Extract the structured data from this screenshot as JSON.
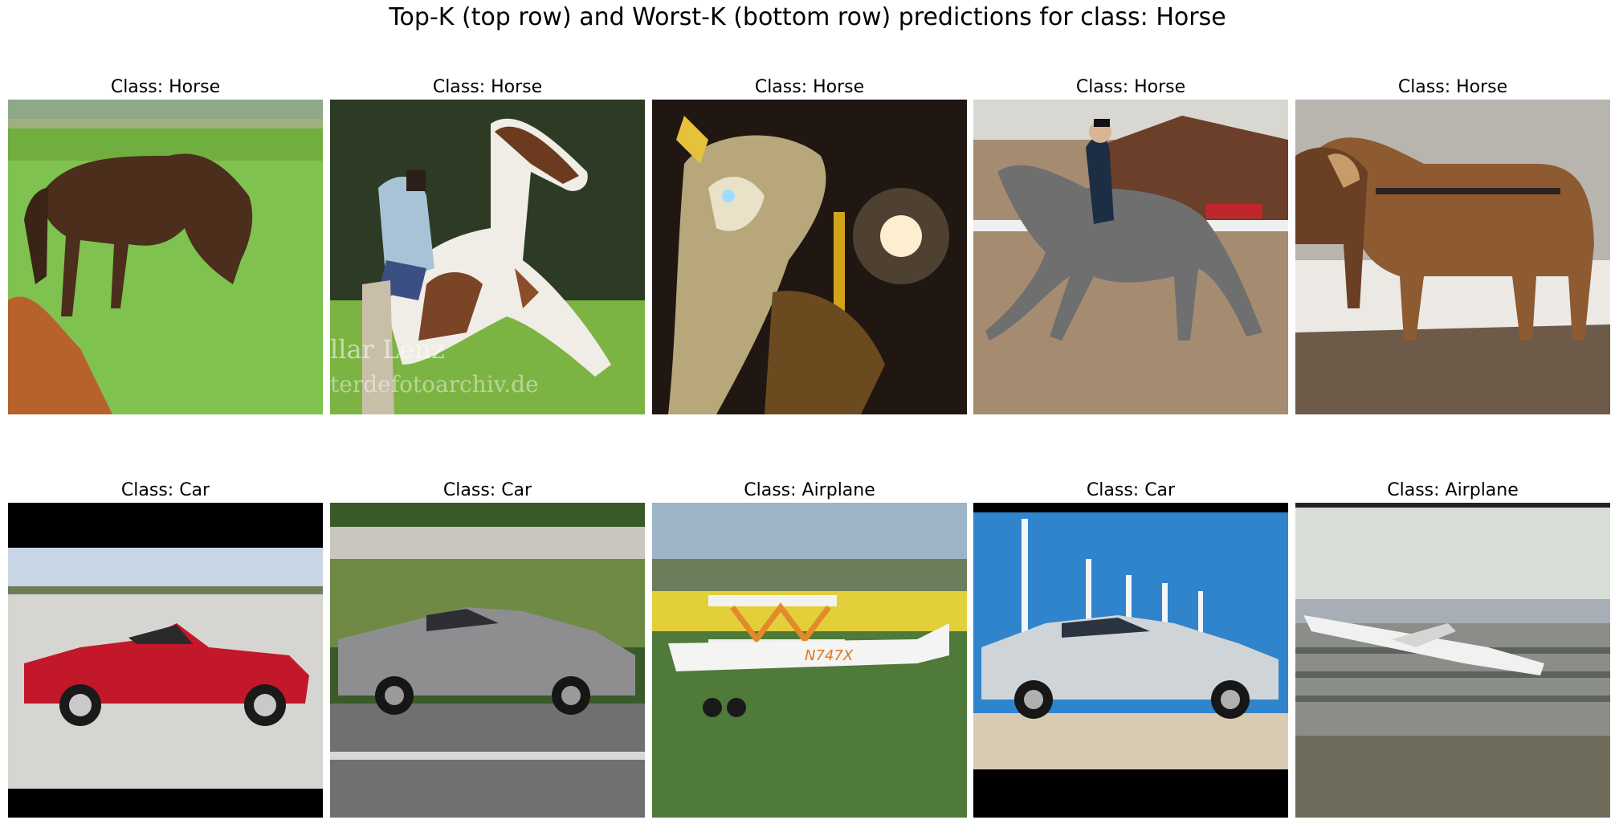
{
  "figure": {
    "title": "Top-K (top row) and Worst-K (bottom row) predictions for class: Horse"
  },
  "rows": [
    {
      "panels": [
        {
          "title": "Class: Horse",
          "scene": "brown horse grazing on green grass"
        },
        {
          "title": "Class: Horse",
          "scene": "woman with white-and-brown horse kneeling; watermark text partly visible"
        },
        {
          "title": "Class: Horse",
          "scene": "ornate carousel horse figure at night with lights"
        },
        {
          "title": "Class: Horse",
          "scene": "rider on grey dressage horse in arena"
        },
        {
          "title": "Class: Horse",
          "scene": "two brown draft horses in harness on snowy ground"
        }
      ]
    },
    {
      "panels": [
        {
          "title": "Class: Car",
          "scene": "red convertible car with black letterbox bars"
        },
        {
          "title": "Class: Car",
          "scene": "grey sports car on road"
        },
        {
          "title": "Class: Airplane",
          "scene": "white biplane flying low over fields"
        },
        {
          "title": "Class: Car",
          "scene": "silver hatchback in front of wind turbines"
        },
        {
          "title": "Class: Airplane",
          "scene": "jet airliner taking off at airport"
        }
      ]
    }
  ],
  "watermark_text": "llar Lenz / erdefotoarchiv.de"
}
